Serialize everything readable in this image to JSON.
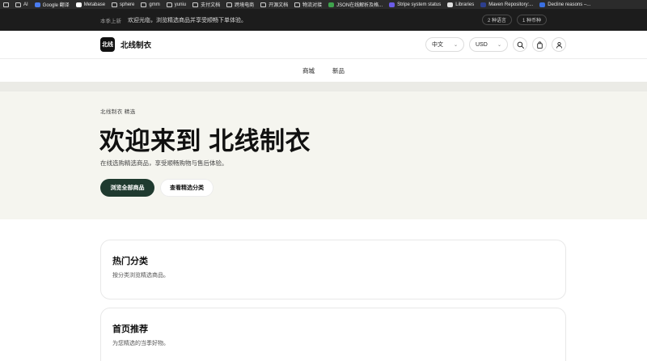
{
  "bookmarks": [
    {
      "label": "",
      "icon": "grid-icon"
    },
    {
      "label": "AI",
      "icon": "folder-icon"
    },
    {
      "label": "Google 翻译",
      "icon": "translate-icon",
      "color": "#4a7cf0"
    },
    {
      "label": "Metabase",
      "icon": "metabase-icon",
      "color": "#ffffff"
    },
    {
      "label": "sphere",
      "icon": "folder-icon"
    },
    {
      "label": "gmm",
      "icon": "folder-icon"
    },
    {
      "label": "yuniu",
      "icon": "folder-icon"
    },
    {
      "label": "支付文档",
      "icon": "folder-icon"
    },
    {
      "label": "跨境电商",
      "icon": "folder-icon"
    },
    {
      "label": "开源文档",
      "icon": "folder-icon"
    },
    {
      "label": "物流对接",
      "icon": "folder-icon"
    },
    {
      "label": "JSON在线解析及格...",
      "icon": "json-icon",
      "color": "#3fa34d"
    },
    {
      "label": "Stripe system status",
      "icon": "stripe-icon",
      "color": "#6b5ce7"
    },
    {
      "label": "Libraries",
      "icon": "libraries-icon",
      "color": "#e0e0e0"
    },
    {
      "label": "Maven Repository:...",
      "icon": "maven-icon",
      "color": "#2d3f8f"
    },
    {
      "label": "Decline reasons –...",
      "icon": "decline-icon",
      "color": "#3a6fe0"
    }
  ],
  "announce": {
    "tag": "本季上新",
    "text": "欢迎光临，浏览精选商品并享受顺畅下单体验。",
    "pill1": "2 种语言",
    "pill2": "1 种币种"
  },
  "header": {
    "logo_text": "北线",
    "brand": "北线制衣",
    "language": "中文",
    "currency": "USD"
  },
  "nav": {
    "items": [
      "商城",
      "新品"
    ]
  },
  "hero": {
    "eyebrow": "北线制衣 精选",
    "title": "欢迎来到 北线制衣",
    "subtitle": "在线选购精选商品，享受顺畅购物与售后体验。",
    "primary_button": "浏览全部商品",
    "secondary_button": "查看精选分类"
  },
  "sections": [
    {
      "title": "热门分类",
      "subtitle": "按分类浏览精选商品。"
    },
    {
      "title": "首页推荐",
      "subtitle": "为您精选的当季好物。"
    }
  ],
  "colors": {
    "primary": "#1f3a2f",
    "hero_bg": "#f5f5ef",
    "top_bar": "#1c1c1c"
  }
}
